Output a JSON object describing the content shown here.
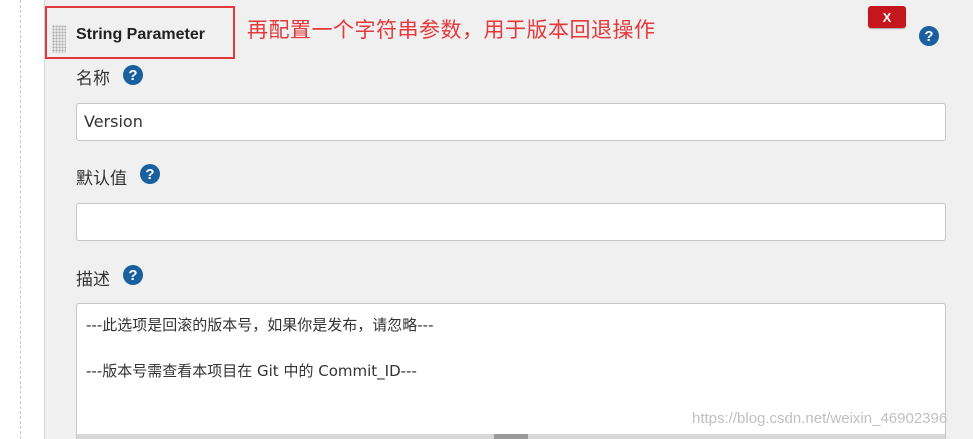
{
  "parameter": {
    "type_title": "String Parameter",
    "annotation": "再配置一个字符串参数，用于版本回退操作",
    "delete_label": "X",
    "help_glyph": "?"
  },
  "fields": {
    "name": {
      "label": "名称",
      "value": "Version"
    },
    "default_value": {
      "label": "默认值",
      "value": ""
    },
    "description": {
      "label": "描述",
      "lines": [
        "---此选项是回滚的版本号，如果你是发布，请忽略---",
        "",
        "---版本号需查看本项目在 Git 中的 Commit_ID---"
      ]
    }
  },
  "watermark": "https://blog.csdn.net/weixin_46902396",
  "colors": {
    "annotation_red": "#e4393c",
    "delete_button": "#c4161c",
    "help_icon": "#1a5f9e",
    "panel_bg": "#f0f0f0"
  },
  "icons": {
    "help": "question-circle-icon",
    "drag": "drag-handle-icon",
    "delete": "close-icon"
  }
}
